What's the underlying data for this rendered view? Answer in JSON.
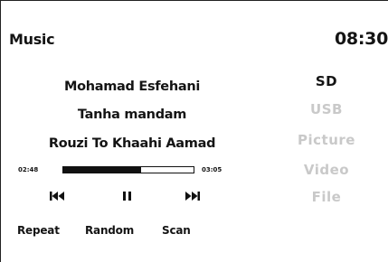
{
  "header": {
    "app_title": "Music",
    "clock": "08:30"
  },
  "now_playing": {
    "artist": "Mohamad Esfehani",
    "title": "Tanha mandam",
    "album": "Rouzi To Khaahi Aamad",
    "elapsed": "02:48",
    "duration": "03:05",
    "progress_fraction": 0.6
  },
  "controls": {
    "previous_icon": "skip-previous-icon",
    "pause_icon": "pause-icon",
    "next_icon": "skip-next-icon"
  },
  "modes": {
    "repeat": "Repeat",
    "random": "Random",
    "scan": "Scan"
  },
  "sources": {
    "items": [
      {
        "label": "SD",
        "active": true
      },
      {
        "label": "USB",
        "active": false
      },
      {
        "label": "Picture",
        "active": false
      },
      {
        "label": "Video",
        "active": false
      },
      {
        "label": "File",
        "active": false
      }
    ],
    "active_color": "#141414",
    "inactive_color": "#c9c9c9"
  }
}
